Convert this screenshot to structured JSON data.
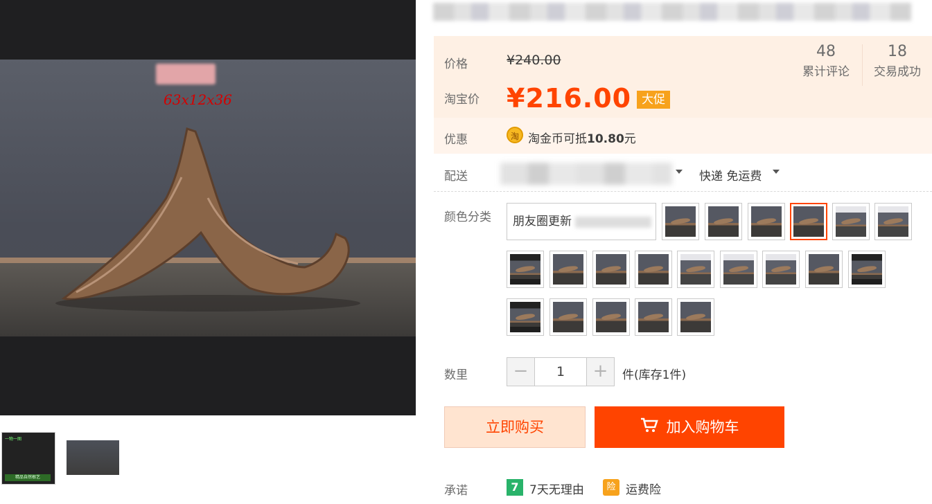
{
  "gallery": {
    "photo_annotation": "63x12x36",
    "thumbnails": [
      "product-photo-1",
      "product-photo-2"
    ]
  },
  "price": {
    "original_label": "价格",
    "original_value": "¥240.00",
    "current_label": "淘宝价",
    "currency_symbol": "¥",
    "current_value": "216.00",
    "promo_tag": "大促"
  },
  "stats": [
    {
      "count": "48",
      "label": "累计评论"
    },
    {
      "count": "18",
      "label": "交易成功"
    }
  ],
  "discount": {
    "label": "优惠",
    "coin_icon_text": "淘",
    "text_prefix": "淘金币可抵",
    "amount": "10.80",
    "text_suffix": "元"
  },
  "shipping": {
    "label": "配送",
    "method": "快递 免运费"
  },
  "sku": {
    "label": "颜色分类",
    "text_option": "朋友圈更新",
    "image_option_count": 20,
    "selected_index": 3
  },
  "quantity": {
    "label": "数里",
    "value": "1",
    "minus": "−",
    "plus": "+",
    "stock": "件(库存1件)"
  },
  "actions": {
    "buy_now": "立即购买",
    "add_cart": "加入购物车"
  },
  "promise": {
    "label": "承诺",
    "items": [
      {
        "icon_text": "7",
        "text": "7天无理由"
      },
      {
        "icon_text": "险",
        "text": "运费险"
      }
    ]
  },
  "colors": {
    "accent": "#ff4400",
    "price_panel": "#fef0e4",
    "promo_tag": "#f7a21c"
  }
}
